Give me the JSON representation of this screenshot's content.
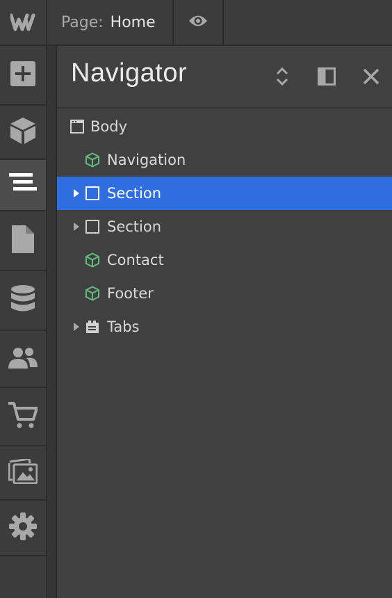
{
  "topbar": {
    "logo_icon": "webflow-logo-icon",
    "page_label": "Page:",
    "page_value": "Home",
    "preview_icon": "eye-icon"
  },
  "rail": {
    "items": [
      {
        "icon": "add-icon",
        "active": false
      },
      {
        "icon": "components-cube-icon",
        "active": false
      },
      {
        "icon": "navigator-icon",
        "active": true
      },
      {
        "icon": "pages-icon",
        "active": false
      },
      {
        "icon": "cms-database-icon",
        "active": false
      },
      {
        "icon": "users-icon",
        "active": false
      },
      {
        "icon": "ecommerce-cart-icon",
        "active": false
      },
      {
        "icon": "assets-images-icon",
        "active": false
      },
      {
        "icon": "settings-gear-icon",
        "active": false
      }
    ]
  },
  "navigator": {
    "title": "Navigator",
    "header_icons": [
      "expand-collapse-icon",
      "dock-panel-icon",
      "close-icon"
    ],
    "tree": [
      {
        "label": "Body",
        "icon": "body-window-icon",
        "level": 0,
        "has_caret": false,
        "selected": false
      },
      {
        "label": "Navigation",
        "icon": "symbol-cube-icon",
        "level": 1,
        "has_caret": false,
        "selected": false
      },
      {
        "label": "Section",
        "icon": "section-square-icon",
        "level": 1,
        "has_caret": true,
        "selected": true
      },
      {
        "label": "Section",
        "icon": "section-square-icon",
        "level": 1,
        "has_caret": true,
        "selected": false
      },
      {
        "label": "Contact",
        "icon": "symbol-cube-icon",
        "level": 1,
        "has_caret": false,
        "selected": false
      },
      {
        "label": "Footer",
        "icon": "symbol-cube-icon",
        "level": 1,
        "has_caret": false,
        "selected": false
      },
      {
        "label": "Tabs",
        "icon": "tabs-icon",
        "level": 1,
        "has_caret": true,
        "selected": false
      }
    ]
  },
  "colors": {
    "selected_row": "#2f6ee0",
    "symbol_green": "#5fbf7f",
    "background": "#404040"
  }
}
